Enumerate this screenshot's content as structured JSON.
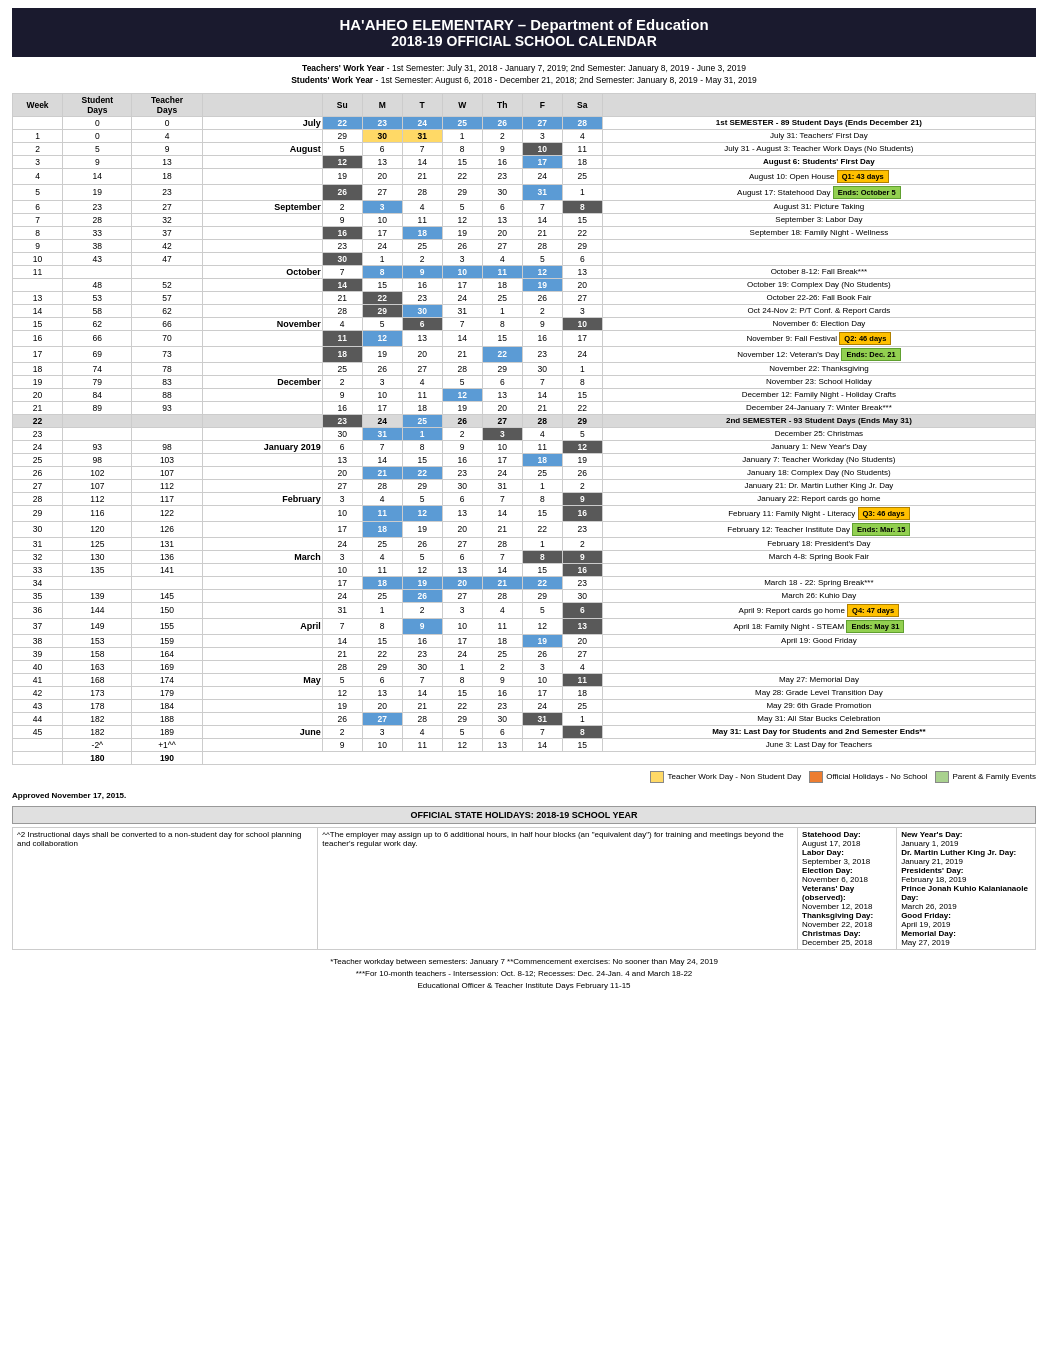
{
  "header": {
    "line1": "HA'AHEO ELEMENTARY – Department of Education",
    "line2": "2018-19 OFFICIAL SCHOOL CALENDAR"
  },
  "subtitle": {
    "teachers": "Teachers' Work Year - 1st Semester: July 31, 2018 - January 7, 2019; 2nd Semester: January 8, 2019 - June 3, 2019",
    "students": "Students' Work Year - 1st Semester: August 6, 2018 - December 21, 2018; 2nd Semester: January 8, 2019 - May 31, 2019"
  },
  "col_headers": {
    "week": "Week",
    "student": "Student",
    "teacher": "Teacher",
    "su": "Su",
    "m": "M",
    "t": "T",
    "w": "W",
    "th": "Th",
    "f": "F",
    "sa": "Sa",
    "days": "Days",
    "days2": "Days"
  },
  "legend": {
    "yellow_label": "Teacher Work Day - Non Student Day",
    "orange_label": "Official Holidays - No School",
    "green_label": "Parent & Family Events"
  },
  "approved": "Approved November 17, 2015.",
  "official_holidays_header": "OFFICIAL STATE HOLIDAYS:  2018-19 SCHOOL YEAR",
  "holidays": [
    {
      "label": "Statehood Day:",
      "date": "August 17, 2018"
    },
    {
      "label": "Labor Day:",
      "date": "September 3, 2018"
    },
    {
      "label": "Election Day:",
      "date": "November 6, 2018"
    },
    {
      "label": "Veterans' Day (observed):",
      "date": "November 12, 2018"
    },
    {
      "label": "Thanksgiving Day:",
      "date": "November 22, 2018"
    },
    {
      "label": "Christmas Day:",
      "date": "December 25, 2018"
    }
  ],
  "holidays2": [
    {
      "label": "New Year's Day:",
      "date": "January 1, 2019"
    },
    {
      "label": "Dr. Martin Luther King Jr. Day:",
      "date": "January 21, 2019"
    },
    {
      "label": "Presidents' Day:",
      "date": "February 18, 2019"
    },
    {
      "label": "Prince Jonah Kuhio Kalanianaole Day:",
      "date": "March 26, 2019"
    },
    {
      "label": "Good Friday:",
      "date": "April 19, 2019"
    },
    {
      "label": "Memorial Day:",
      "date": "May 27, 2019"
    }
  ],
  "footnote1": "^2 Instructional days shall be converted to a non-student day for school planning and collaboration",
  "footnote2": "^^The employer may assign up to 6 additional hours, in half hour blocks (an \"equivalent day\") for training and meetings beyond the teacher's regular work day.",
  "footnote3": "*Teacher workday between semesters: January 7  **Commencement exercises: No sooner than May 24, 2019",
  "footnote4": "***For 10-month teachers - Intersession: Oct. 8-12; Recesses: Dec. 24-Jan. 4 and March 18-22",
  "footnote5": "Educational Officer & Teacher Institute Days February 11-15"
}
